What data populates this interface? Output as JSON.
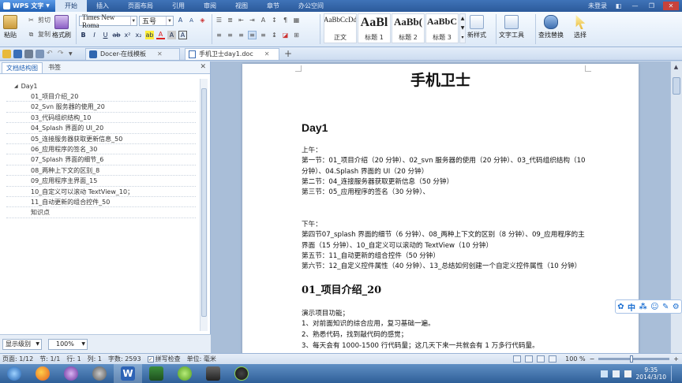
{
  "app": {
    "name": "WPS 文字",
    "user_status": "未登录"
  },
  "menus": [
    "开始",
    "插入",
    "页面布局",
    "引用",
    "审阅",
    "视图",
    "章节",
    "办公空间"
  ],
  "ribbon": {
    "paste": "粘贴",
    "cut": "剪切",
    "copy": "复制",
    "format_painter": "格式刷",
    "font_name": "Times New Roma",
    "font_size": "五号",
    "styles": [
      {
        "sample": "AaBbCcDd",
        "label": "正文"
      },
      {
        "sample": "AaBl",
        "label": "标题 1"
      },
      {
        "sample": "AaBb(",
        "label": "标题 2"
      },
      {
        "sample": "AaBbC",
        "label": "标题 3"
      }
    ],
    "new_style": "新样式",
    "text_tools": "文字工具",
    "find_replace": "查找替换",
    "select": "选择"
  },
  "tabs": [
    {
      "label": "Docer-在线模板",
      "active": false
    },
    {
      "label": "手机卫士day1.doc",
      "active": true
    }
  ],
  "left_pane": {
    "tabs": [
      "文档结构图",
      "书签"
    ],
    "root": "Day1",
    "items": [
      "01_项目介绍_20",
      "02_Svn 服务器的使用_20",
      "03_代码组织结构_10",
      "04_Splash 界面的 UI_20",
      "05_连接服务器获取更新信息_50",
      "06_应用程序的签名_30",
      "07_Splash 界面的细节_6",
      "08_两种上下文的区别_8",
      "09_应用程序主界面_15",
      "10_自定义可以滚动 TextView_10；",
      "11_自动更新的组合控件_50",
      "知识点"
    ],
    "level_combo": "显示级别",
    "zoom_combo": "100%"
  },
  "document": {
    "title": "手机卫士",
    "heading": "Day1",
    "morning_label": "上午：",
    "morning_lines": [
      "第一节：01_项目介绍（20 分钟）、02_svn 服务器的使用（20 分钟）、03_代码组织结构（10 分钟）、04.Splash 界面的 UI（20 分钟）",
      "第二节：04_连接服务器获取更新信息（50 分钟）",
      "第三节：05_应用程序的签名（30 分钟）、"
    ],
    "afternoon_label": "下午：",
    "afternoon_lines": [
      "第四节07_splash 界面的细节（6 分钟）、08_两种上下文的区别（8 分钟）、09_应用程序的主界面（15 分钟）、10_自定义可以滚动的 TextView（10 分钟）",
      "第五节：11_自动更新的组合控件（50 分钟）",
      "第六节：12_自定义控件属性（40 分钟）、13_总结如何创建一个自定义控件属性（10 分钟）"
    ],
    "section_heading": "01_项目介绍_20",
    "body_lines": [
      "演示项目功能；",
      "1、对前面知识的综合应用，复习基础一遍。",
      "2、熟悉代码，找到敲代码的感觉；",
      "3、每天会有 1000-1500 行代码量；这几天下来一共就会有 1 万多行代码量。"
    ]
  },
  "status": {
    "page": "页面: 1/12",
    "section": "节: 1/1",
    "row": "行: 1",
    "col": "列: 1",
    "words": "字数: 2593",
    "spell": "拼写检查",
    "unit": "单位: 毫米",
    "zoom": "100 %"
  },
  "taskbar": {
    "time": "9:35",
    "date": "2014/3/10"
  },
  "colors": {
    "accent": "#2c5a9a",
    "ribbon_bg": "#dde9f7",
    "doc_bg": "#a9bed8"
  }
}
